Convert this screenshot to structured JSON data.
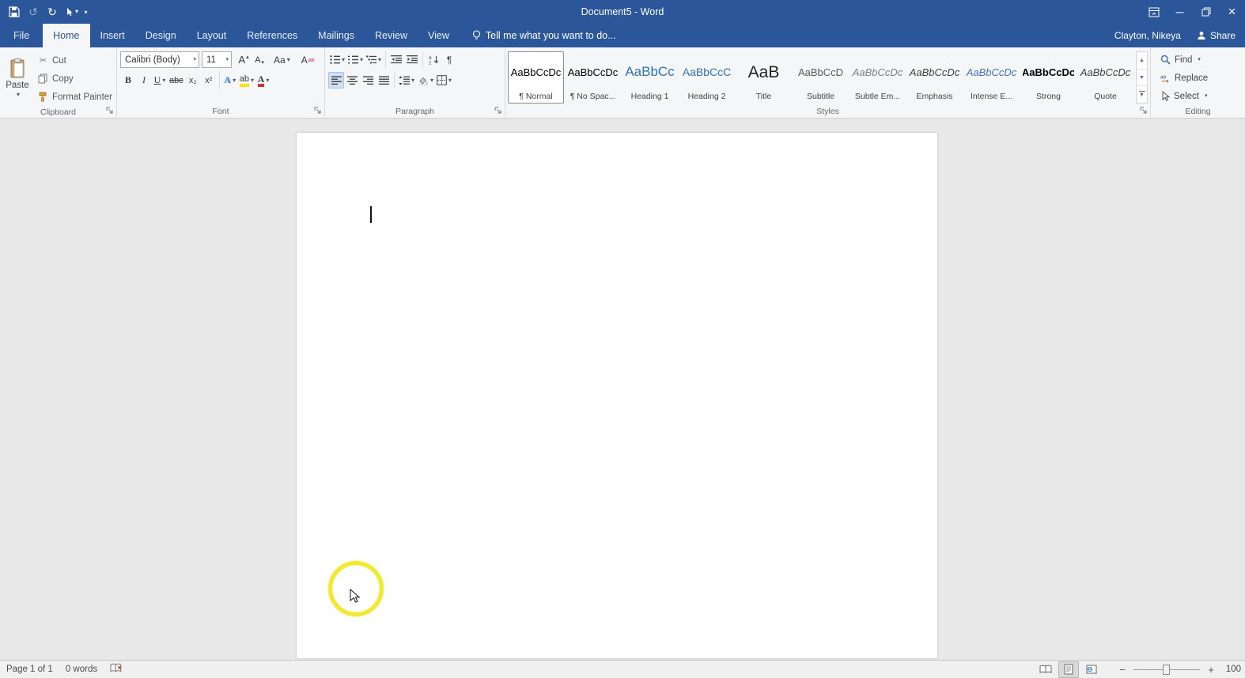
{
  "titlebar": {
    "title": "Document5 - Word"
  },
  "account": {
    "user_name": "Clayton, Nikeya",
    "share_label": "Share"
  },
  "tabs": {
    "file_label": "File",
    "items": [
      "Home",
      "Insert",
      "Design",
      "Layout",
      "References",
      "Mailings",
      "Review",
      "View"
    ],
    "active": "Home",
    "tell_me_placeholder": "Tell me what you want to do..."
  },
  "ribbon": {
    "clipboard": {
      "group_label": "Clipboard",
      "paste_label": "Paste",
      "cut_label": "Cut",
      "copy_label": "Copy",
      "format_painter_label": "Format Painter"
    },
    "font": {
      "group_label": "Font",
      "font_name": "Calibri (Body)",
      "font_size": "11",
      "grow_glyph": "A",
      "shrink_glyph": "A",
      "change_case_glyph": "Aa",
      "clear_formatting_glyph": "A",
      "bold_glyph": "B",
      "italic_glyph": "I",
      "underline_glyph": "U",
      "strikethrough_glyph": "abc",
      "subscript_glyph": "x₂",
      "superscript_glyph": "x²",
      "text_effects_glyph": "A",
      "highlight_glyph": "ab",
      "font_color_glyph": "A"
    },
    "paragraph": {
      "group_label": "Paragraph",
      "show_hide_glyph": "¶"
    },
    "styles": {
      "group_label": "Styles",
      "items": [
        {
          "preview": "AaBbCcDc",
          "label": "¶ Normal",
          "color": "#000000",
          "size": 13,
          "selected": true
        },
        {
          "preview": "AaBbCcDc",
          "label": "¶ No Spac...",
          "color": "#000000",
          "size": 13
        },
        {
          "preview": "AaBbCc",
          "label": "Heading 1",
          "color": "#2e74b5",
          "size": 17
        },
        {
          "preview": "AaBbCcC",
          "label": "Heading 2",
          "color": "#2e74b5",
          "size": 14
        },
        {
          "preview": "AaB",
          "label": "Title",
          "color": "#1f1f1f",
          "size": 21
        },
        {
          "preview": "AaBbCcD",
          "label": "Subtitle",
          "color": "#5a5a5a",
          "size": 13
        },
        {
          "preview": "AaBbCcDc",
          "label": "Subtle Em...",
          "color": "#7f7f7f",
          "size": 13,
          "italic": true
        },
        {
          "preview": "AaBbCcDc",
          "label": "Emphasis",
          "color": "#404040",
          "size": 13,
          "italic": true
        },
        {
          "preview": "AaBbCcDc",
          "label": "Intense E...",
          "color": "#4472c4",
          "size": 13,
          "italic": true
        },
        {
          "preview": "AaBbCcDc",
          "label": "Strong",
          "color": "#000000",
          "size": 13,
          "bold": true
        },
        {
          "preview": "AaBbCcDc",
          "label": "Quote",
          "color": "#404040",
          "size": 13,
          "italic": true
        }
      ]
    },
    "editing": {
      "group_label": "Editing",
      "find_label": "Find",
      "replace_label": "Replace",
      "select_label": "Select"
    }
  },
  "statusbar": {
    "page_info": "Page 1 of 1",
    "word_count": "0 words",
    "zoom_level": "100"
  },
  "icons": {
    "undo": "↺",
    "redo": "↻",
    "dropdown": "▾",
    "minimize": "─",
    "close": "×",
    "scissors": "✂",
    "gallery_up": "▲",
    "gallery_down": "▼",
    "zoom_out": "−",
    "zoom_in": "+"
  },
  "colors": {
    "titlebar_blue": "#2b579a",
    "heading_blue": "#2e74b5",
    "accent_blue": "#4472c4",
    "highlight_yellow": "#ffe400",
    "font_color_red": "#d93025",
    "click_circle_yellow": "#f0e832"
  }
}
